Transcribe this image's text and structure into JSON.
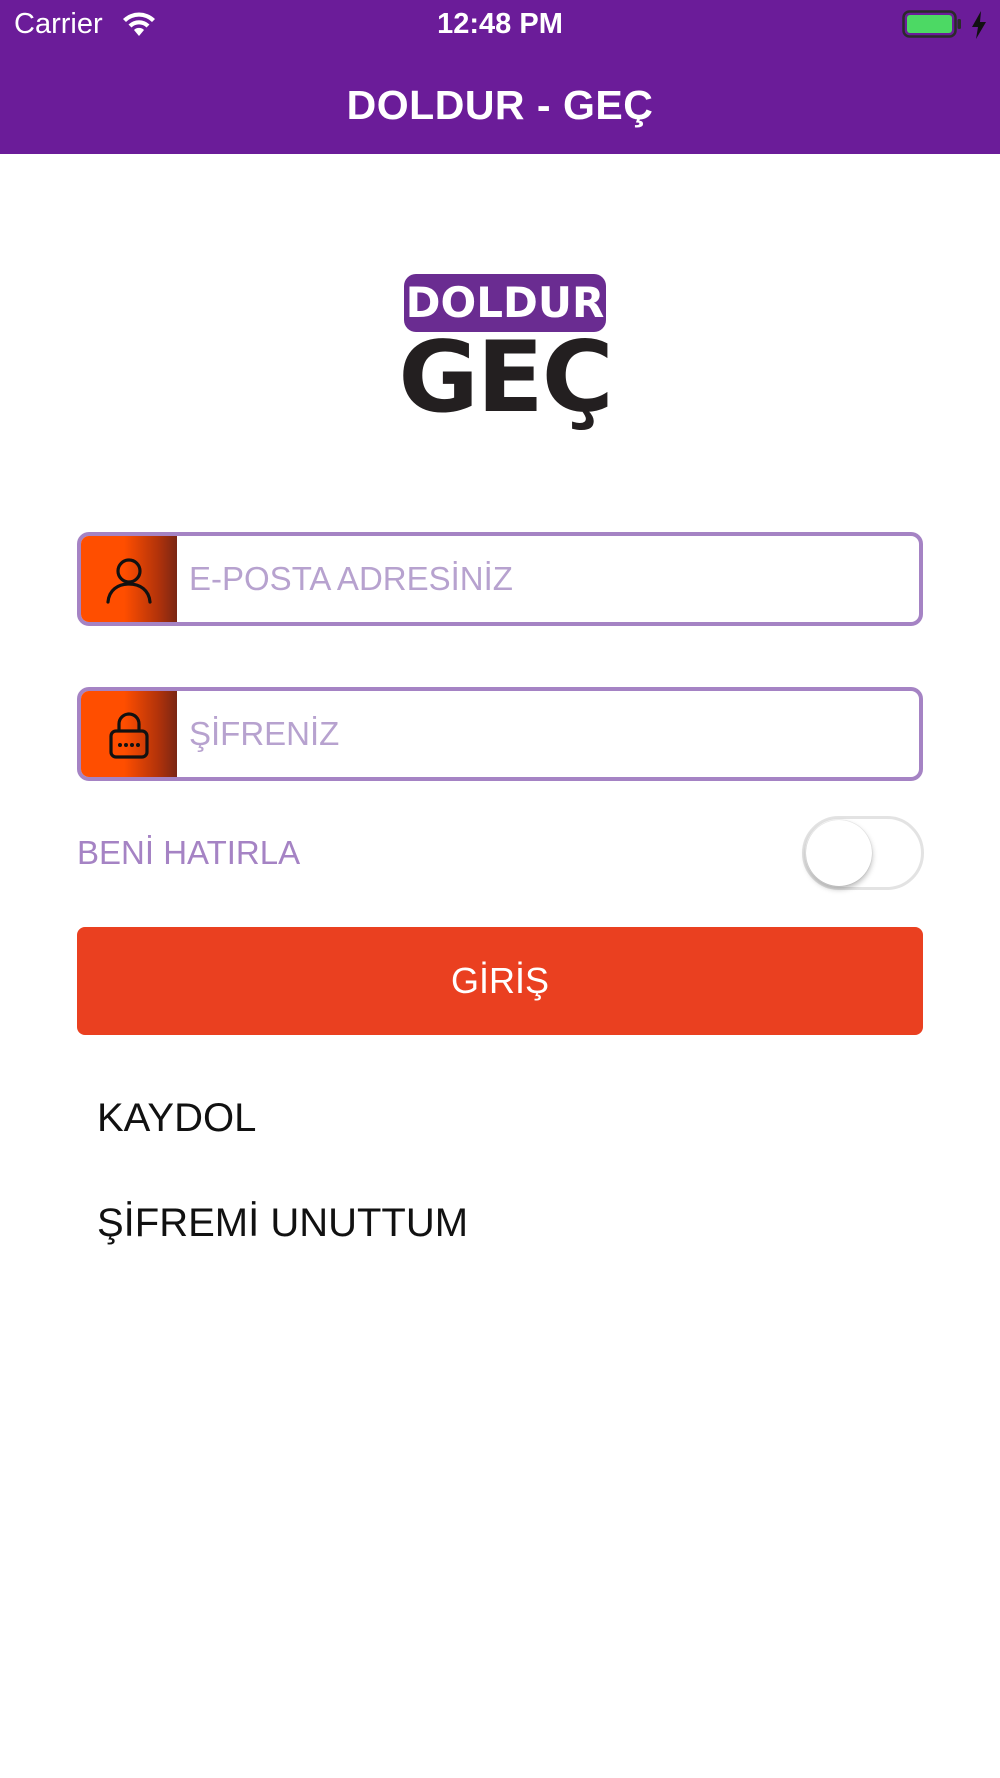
{
  "status_bar": {
    "carrier": "Carrier",
    "time": "12:48 PM",
    "wifi_icon": "wifi-icon",
    "battery_icon": "battery-icon",
    "battery_level": 1.0,
    "charging_icon": "charging-bolt-icon"
  },
  "nav": {
    "title": "DOLDUR - GEÇ",
    "background_color": "#6b1c99"
  },
  "logo": {
    "top_word": "DOLDUR",
    "bottom_word": "GEÇ",
    "top_color": "#6a2c91",
    "bottom_color": "#231f20"
  },
  "form": {
    "email": {
      "placeholder": "E-POSTA ADRESİNİZ",
      "value": "",
      "icon": "user-icon"
    },
    "password": {
      "placeholder": "ŞİFRENİZ",
      "value": "",
      "icon": "lock-icon"
    },
    "remember_me": {
      "label": "BENİ HATIRLA",
      "on": false
    },
    "login_button": "GİRİŞ"
  },
  "links": {
    "register": "KAYDOL",
    "forgot_password": "ŞİFREMİ UNUTTUM"
  },
  "colors": {
    "accent_purple": "#a583c4",
    "button_red": "#ea4020",
    "icon_orange": "#ff4e00"
  }
}
